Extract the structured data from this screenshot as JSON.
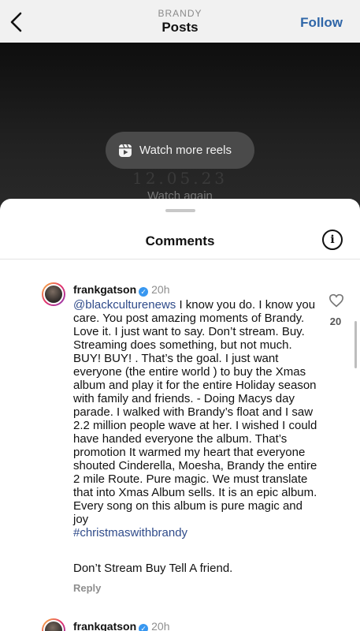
{
  "header": {
    "account": "BRANDY",
    "title": "Posts",
    "follow_label": "Follow"
  },
  "video": {
    "reels_label": "Watch more reels",
    "date_text": "12.05.23",
    "watch_again": "Watch again"
  },
  "comments_sheet": {
    "title": "Comments",
    "comments": [
      {
        "username": "frankgatson",
        "time": "20h",
        "mention": "@blackculturenews",
        "text": " I know you do. I know you care. You post amazing moments of Brandy. Love it. I just want to say. Don’t stream.  Buy.  Streaming does something, but not much.  BUY!  BUY! .  That’s the goal. I just want everyone (the entire world ) to buy the Xmas album and play it for the entire Holiday season with family and friends. - Doing Macys day parade. I walked with Brandy’s float and I saw 2.2 million people wave at her. I wished I could have handed everyone the album. That’s promotion It warmed my heart that everyone shouted Cinderella, Moesha, Brandy the entire 2 mile Route.  Pure magic. We must translate that into Xmas Album sells.  It is an epic album. Every song on this album is pure magic and joy",
        "hashtag": "#christmaswithbrandy",
        "extra": "Don’t Stream Buy  Tell A friend.",
        "reply_label": "Reply",
        "like_count": "20"
      },
      {
        "username": "frankgatson",
        "time": "20h"
      }
    ]
  },
  "icons": [
    "back-chevron-icon",
    "reels-icon",
    "info-icon",
    "verified-icon",
    "heart-icon"
  ],
  "colors": {
    "link": "#2f4b8a",
    "follow": "#2f66a8",
    "verified": "#3897f0"
  }
}
